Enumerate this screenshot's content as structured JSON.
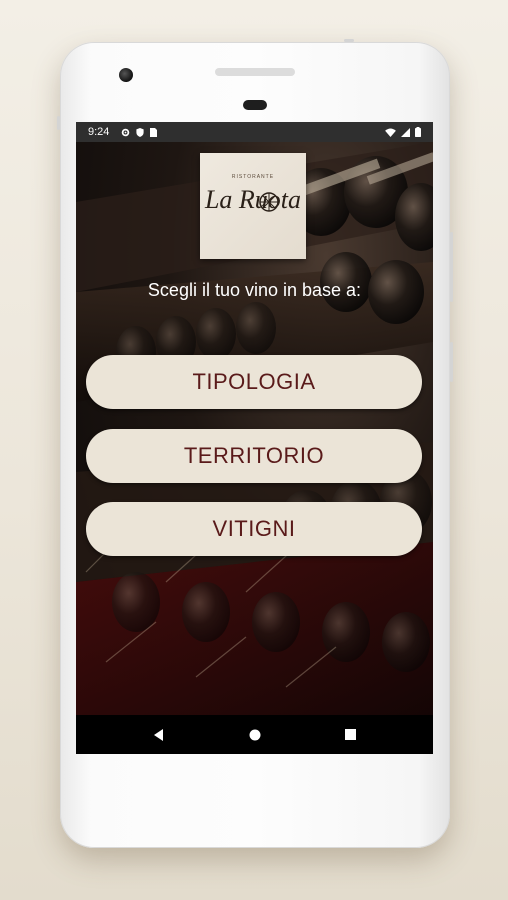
{
  "status_bar": {
    "time": "9:24",
    "left_icons": [
      "gear-icon",
      "shield-icon",
      "sim-card-icon"
    ],
    "right_icons": [
      "wifi-icon",
      "signal-icon",
      "battery-icon"
    ]
  },
  "logo": {
    "small_text": "RISTORANTE",
    "script_text": "La Ruota"
  },
  "prompt": "Scegli il tuo vino in base a:",
  "buttons": [
    {
      "label": "TIPOLOGIA"
    },
    {
      "label": "TERRITORIO"
    },
    {
      "label": "VITIGNI"
    }
  ],
  "nav_bar": [
    "back-icon",
    "home-icon",
    "recents-icon"
  ],
  "colors": {
    "button_bg": "#ebe4d7",
    "button_text": "#5a1a1a",
    "status_bar_bg": "#2f2f2f"
  }
}
